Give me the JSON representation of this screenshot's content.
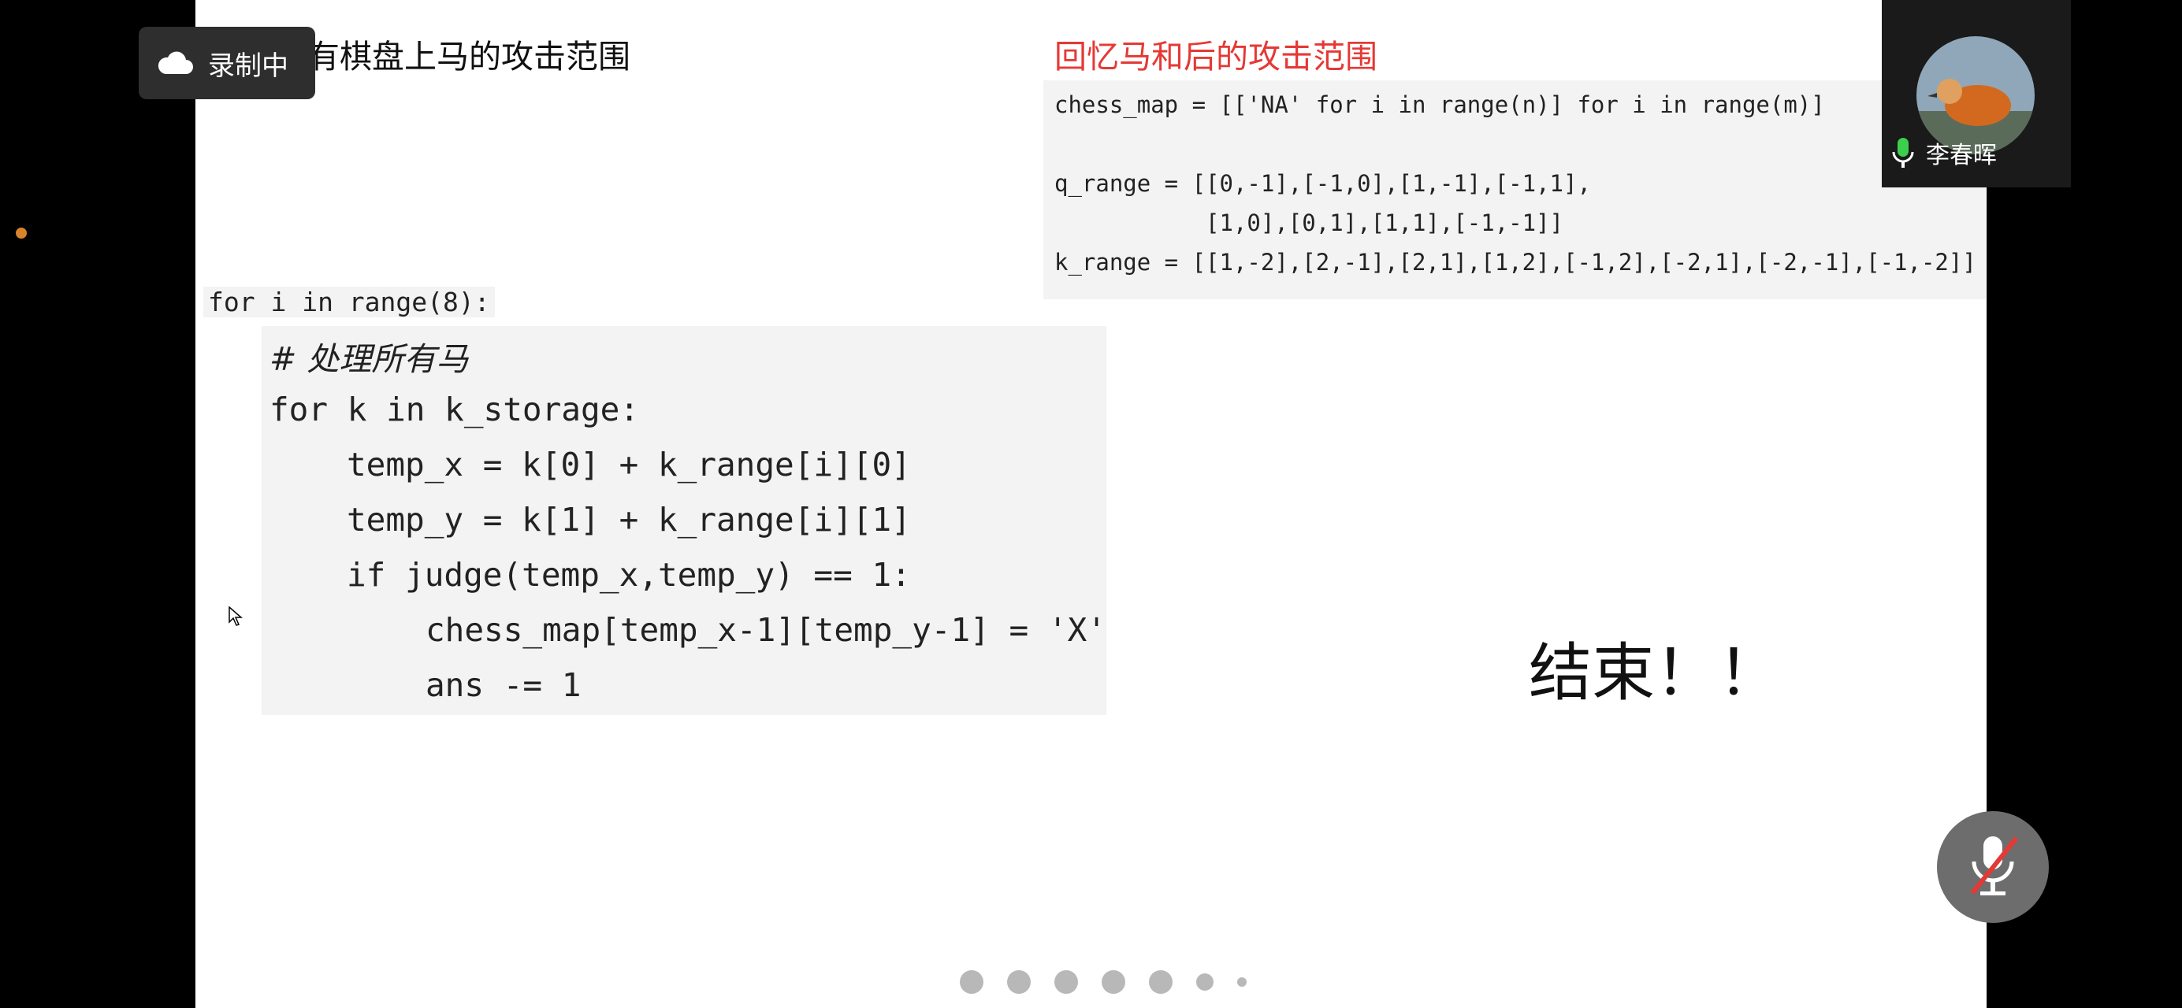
{
  "recording": {
    "label": "录制中",
    "icon": "cloud-icon"
  },
  "slide": {
    "title_left": "有棋盘上马的攻击范围",
    "title_right": "回忆马和后的攻击范围",
    "end_text": "结束！！"
  },
  "code_top": {
    "line1": "chess_map = [['NA' for i in range(n)] for i in range(m)]",
    "line2": "q_range = [[0,-1],[-1,0],[1,-1],[-1,1],",
    "line3": "           [1,0],[0,1],[1,1],[-1,-1]]",
    "line4": "k_range = [[1,-2],[2,-1],[2,1],[1,2],[-1,2],[-2,1],[-2,-1],[-1,-2]]"
  },
  "code_main": {
    "for_line": "for i in range(8):",
    "comment": "# 处理所有马",
    "l1": "for k in k_storage:",
    "l2": "temp_x = k[0] + k_range[i][0]",
    "l3": "temp_y = k[1] + k_range[i][1]",
    "l4": "if judge(temp_x,temp_y) == 1:",
    "l5": "chess_map[temp_x-1][temp_y-1] = 'X'",
    "l6": "ans -= 1"
  },
  "participant": {
    "name": "李春晖",
    "mic": "mic-on-icon"
  },
  "controls": {
    "mute_icon": "mic-muted-icon"
  },
  "pagination": {
    "count": 7
  },
  "colors": {
    "accent_red": "#e53935",
    "keyword": "#8e24aa",
    "builtin": "#a0771f",
    "string": "#2e7d32"
  }
}
